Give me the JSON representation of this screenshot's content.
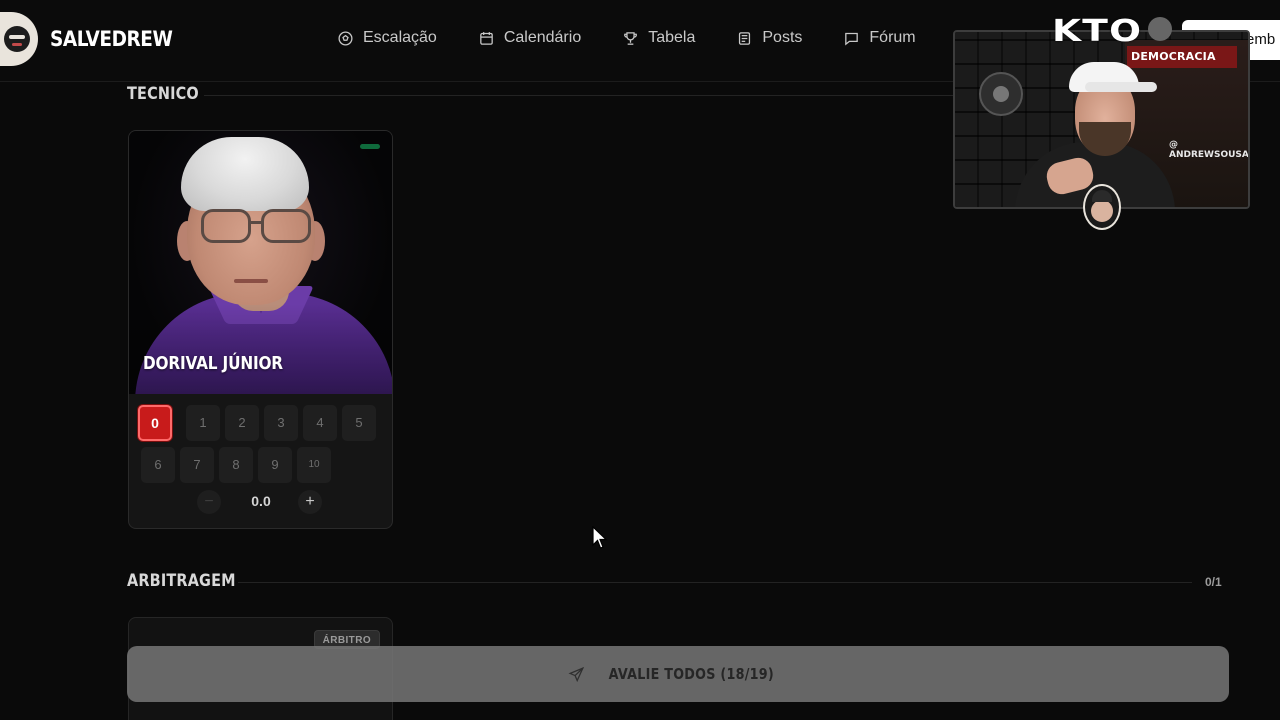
{
  "app": {
    "brand": "SALVEDREW"
  },
  "nav": {
    "items": [
      {
        "label": "Escalação",
        "icon": "soccer-ball-icon"
      },
      {
        "label": "Calendário",
        "icon": "calendar-icon"
      },
      {
        "label": "Tabela",
        "icon": "trophy-icon"
      },
      {
        "label": "Posts",
        "icon": "newspaper-icon"
      },
      {
        "label": "Fórum",
        "icon": "chat-bubble-icon"
      }
    ],
    "header_button_label": "emb"
  },
  "tecnico": {
    "title": "TECNICO",
    "card": {
      "name": "DORIVAL JÚNIOR",
      "scores_row1": [
        "0",
        "1",
        "2",
        "3",
        "4",
        "5"
      ],
      "scores_row2": [
        "6",
        "7",
        "8",
        "9",
        "10"
      ],
      "selected_score": "0",
      "value": "0.0",
      "minus_label": "−",
      "plus_label": "+"
    }
  },
  "arbitragem": {
    "title": "ARBITRAGEM",
    "count": "0/1",
    "card_badge": "ÁRBITRO"
  },
  "submit": {
    "label": "AVALIE TODOS (18/19)",
    "icon": "send-icon"
  },
  "overlay": {
    "sponsor": "KTO",
    "banner_text": "DEMOCRACIA",
    "handle": "@ ANDREWSOUSA"
  },
  "colors": {
    "accent": "#c81b1b",
    "background": "#0a0a0a",
    "status": "#0f6b3c"
  }
}
